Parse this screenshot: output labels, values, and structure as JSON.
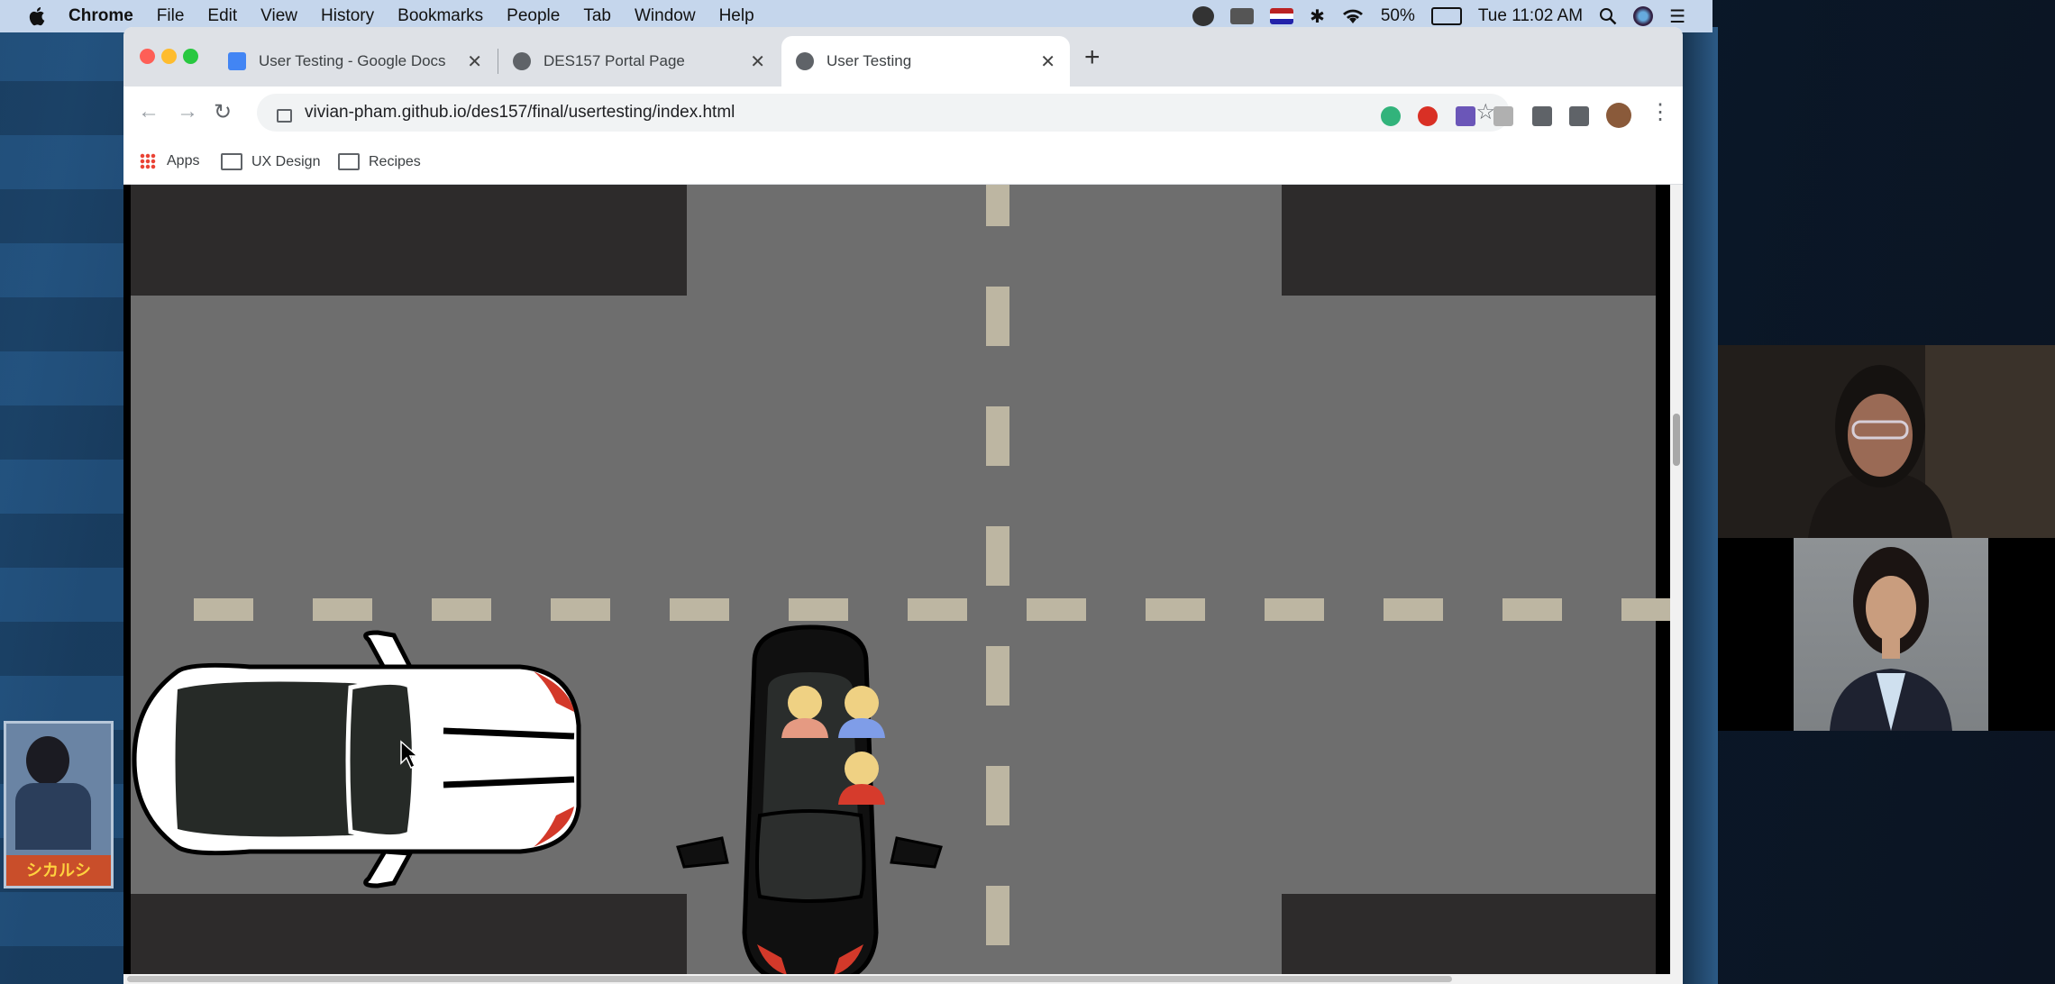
{
  "menubar": {
    "app": "Chrome",
    "items": [
      "File",
      "Edit",
      "View",
      "History",
      "Bookmarks",
      "People",
      "Tab",
      "Window",
      "Help"
    ],
    "battery": "50%",
    "clock": "Tue 11:02 AM"
  },
  "browser": {
    "tabs": [
      {
        "title": "User Testing - Google Docs",
        "icon": "google-docs-icon"
      },
      {
        "title": "DES157 Portal Page",
        "icon": "globe-icon"
      },
      {
        "title": "User Testing",
        "icon": "globe-icon",
        "active": true
      }
    ],
    "url": "vivian-pham.github.io/des157/final/usertesting/index.html",
    "bookmarks": [
      "Apps",
      "UX Design",
      "Recipes"
    ]
  },
  "desktop": {
    "poster_text": "シカルシ"
  },
  "scene": {
    "road_color": "#6e6e6e",
    "block_color": "#2d2b2b",
    "lane_marking_color": "#bdb6a2",
    "white_car_color": "#ffffff",
    "black_car_color": "#101010",
    "passenger_colors": [
      "#e59a82",
      "#7f9de8",
      "#d63b2c"
    ]
  },
  "video_call": {
    "participants": 2
  }
}
